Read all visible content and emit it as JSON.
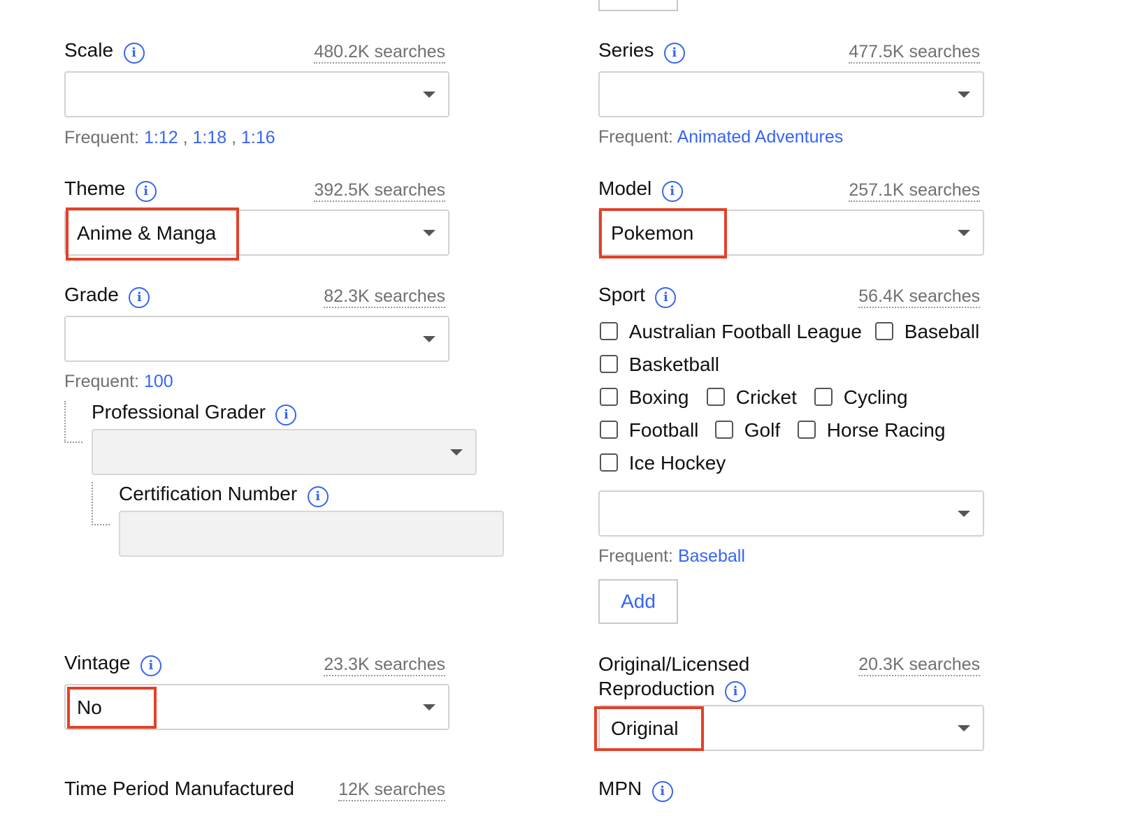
{
  "left": {
    "scale": {
      "label": "Scale",
      "searches": "480.2K searches",
      "value": "",
      "frequent_prefix": "Frequent:",
      "frequent": [
        "1:12",
        "1:18",
        "1:16"
      ]
    },
    "theme": {
      "label": "Theme",
      "searches": "392.5K searches",
      "value": "Anime & Manga"
    },
    "grade": {
      "label": "Grade",
      "searches": "82.3K searches",
      "value": "",
      "frequent_prefix": "Frequent:",
      "frequent": [
        "100"
      ]
    },
    "professional_grader": {
      "label": "Professional Grader",
      "value": ""
    },
    "certification_number": {
      "label": "Certification Number",
      "value": ""
    },
    "vintage": {
      "label": "Vintage",
      "searches": "23.3K searches",
      "value": "No"
    },
    "time_period": {
      "label": "Time Period Manufactured",
      "searches": "12K searches"
    }
  },
  "right": {
    "series": {
      "label": "Series",
      "searches": "477.5K searches",
      "value": "",
      "frequent_prefix": "Frequent:",
      "frequent": [
        "Animated Adventures"
      ]
    },
    "model": {
      "label": "Model",
      "searches": "257.1K searches",
      "value": "Pokemon"
    },
    "sport": {
      "label": "Sport",
      "searches": "56.4K searches",
      "options": [
        "Australian Football League",
        "Baseball",
        "Basketball",
        "Boxing",
        "Cricket",
        "Cycling",
        "Football",
        "Golf",
        "Horse Racing",
        "Ice Hockey"
      ],
      "value": "",
      "frequent_prefix": "Frequent:",
      "frequent": [
        "Baseball"
      ],
      "add_label": "Add"
    },
    "original_licensed": {
      "label_line1": "Original/Licensed",
      "label_line2": "Reproduction",
      "searches": "20.3K searches",
      "value": "Original"
    },
    "mpn": {
      "label": "MPN"
    }
  },
  "icons": {
    "info": "info-icon",
    "caret": "chevron-down-icon"
  },
  "colors": {
    "link": "#3665f3",
    "highlight": "#e2412a",
    "muted": "#707070"
  }
}
